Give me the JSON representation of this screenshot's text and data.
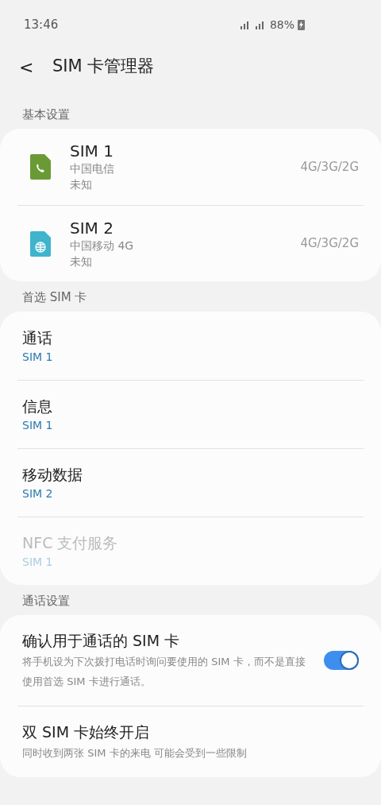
{
  "status_bar": {
    "time": "13:46",
    "battery": "88%"
  },
  "header": {
    "back": "<",
    "title": "SIM 卡管理器"
  },
  "sections": [
    {
      "label": "基本设置",
      "kind": "sims",
      "items": [
        {
          "name": "SIM 1",
          "carrier": "中国电信",
          "status": "未知",
          "network": "4G/3G/2G",
          "color": "#6a9a35",
          "kind": "phone"
        },
        {
          "name": "SIM 2",
          "carrier": "中国移动 4G",
          "status": "未知",
          "network": "4G/3G/2G",
          "color": "#3fb4cc",
          "kind": "globe"
        }
      ]
    },
    {
      "label": "首选 SIM 卡",
      "kind": "prefs",
      "items": [
        {
          "title": "通话",
          "value": "SIM 1",
          "disabled": false
        },
        {
          "title": "信息",
          "value": "SIM 1",
          "disabled": false
        },
        {
          "title": "移动数据",
          "value": "SIM 2",
          "disabled": false
        },
        {
          "title": "NFC 支付服务",
          "value": "SIM 1",
          "disabled": true
        }
      ]
    },
    {
      "label": "通话设置",
      "kind": "switches",
      "items": [
        {
          "kind": "switch",
          "title": "确认用于通话的 SIM 卡",
          "description": "将手机设为下次拨打电话时询问要使用的 SIM 卡，而不是直接使用首选 SIM 卡进行通话。",
          "on": true
        },
        {
          "kind": "plain",
          "title": "双 SIM 卡始终开启",
          "description": "同时收到两张 SIM 卡的来电 可能会受到一些限制"
        }
      ]
    }
  ]
}
